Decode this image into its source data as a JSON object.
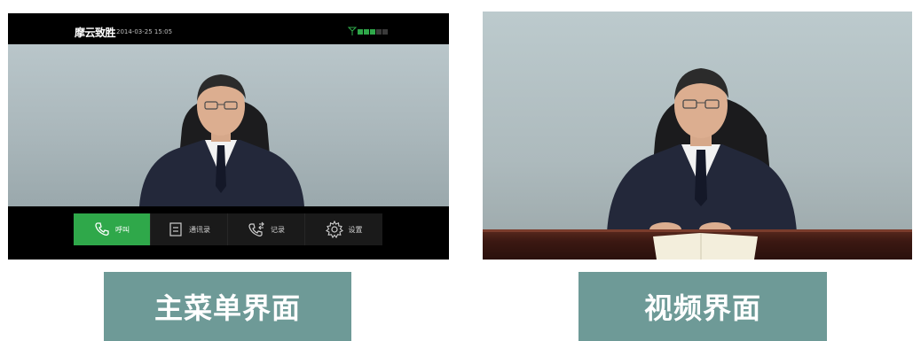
{
  "main_screen": {
    "brand": "摩云致胜",
    "datetime": "2014-03-25 15:05",
    "signal": {
      "bars_active": 3,
      "bars_total": 5,
      "active_color": "#2fa84a",
      "inactive_color": "#3a3a3a"
    },
    "menu": [
      {
        "label": "呼叫",
        "icon": "phone-icon",
        "active": true
      },
      {
        "label": "通讯录",
        "icon": "contacts-icon",
        "active": false
      },
      {
        "label": "记录",
        "icon": "call-log-icon",
        "active": false
      },
      {
        "label": "设置",
        "icon": "gear-icon",
        "active": false
      }
    ]
  },
  "captions": {
    "left": "主菜单界面",
    "right": "视频界面"
  },
  "colors": {
    "accent_green": "#2fa84a",
    "caption_bg": "#6e9a97"
  }
}
